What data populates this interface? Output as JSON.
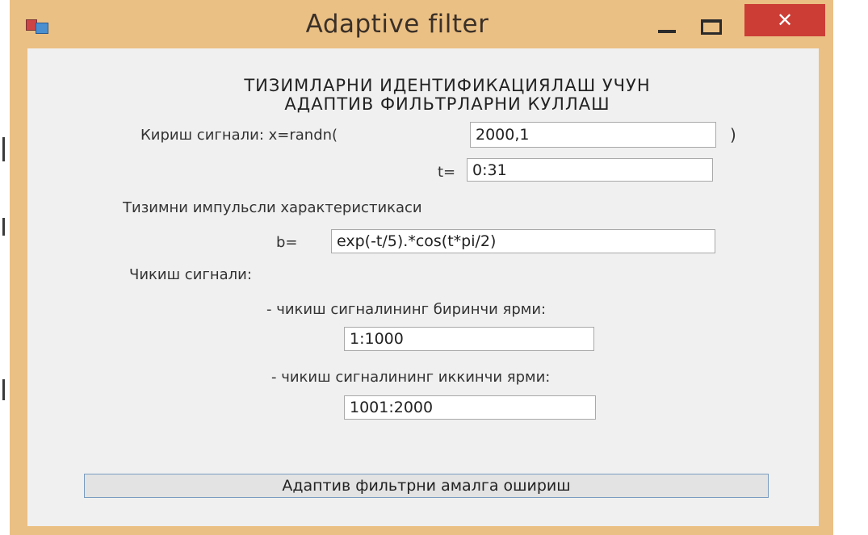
{
  "window": {
    "title": "Adaptive filter",
    "close_glyph": "✕"
  },
  "form": {
    "heading": "ТИЗИМЛАРНИ ИДЕНТИФИКАЦИЯЛАШ УЧУН\nАДАПТИВ ФИЛЬТРЛАРНИ КУЛЛАШ",
    "input_signal_label": "Кириш сигнали: x=randn(",
    "input_signal_value": "2000,1",
    "input_signal_close": ")",
    "t_label": "t=",
    "t_value": "0:31",
    "impulse_label": "Тизимни импульсли характеристикаси",
    "b_label": "b=",
    "b_value": "exp(-t/5).*cos(t*pi/2)",
    "output_label": "Чикиш сигнали:",
    "first_half_label": "- чикиш сигналининг биринчи ярми:",
    "first_half_value": "1:1000",
    "second_half_label": "- чикиш сигналининг иккинчи ярми:",
    "second_half_value": "1001:2000",
    "run_button": "Адаптив фильтрни амалга ошириш"
  },
  "colors": {
    "window_frame": "#ebc084",
    "client_bg": "#f0f0f0",
    "close_button": "#cc3d36"
  }
}
